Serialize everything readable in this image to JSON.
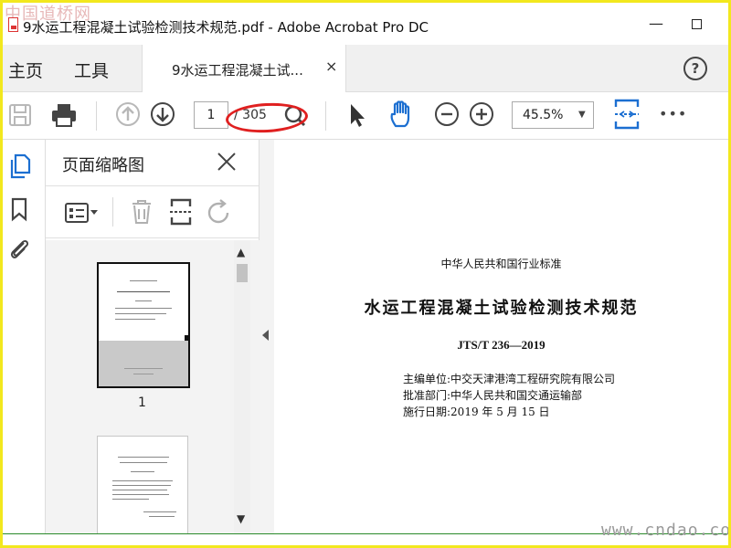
{
  "window": {
    "title": "9水运工程混凝土试验检测技术规范.pdf - Adobe Acrobat Pro DC",
    "minimize_glyph": "—",
    "watermark_top": "中国道桥网",
    "watermark_bottom": "www.cndao.com"
  },
  "tabs": {
    "home": "主页",
    "tools": "工具",
    "document": "9水运工程混凝土试...",
    "close_glyph": "×",
    "help_glyph": "?"
  },
  "toolbar": {
    "page_current": "1",
    "page_total": "/ 305",
    "zoom": "45.5%",
    "zoom_arrow": "▼",
    "more_glyph": "•••",
    "highlight_color": "#e02020",
    "accent_color": "#1c6fd1",
    "icons": [
      "save-icon",
      "print-icon",
      "prev-page-icon",
      "next-page-icon",
      "find-icon",
      "select-pointer-icon",
      "hand-tool-icon",
      "zoom-out-icon",
      "zoom-in-icon",
      "fit-page-icon",
      "more-icon"
    ]
  },
  "sidebar": {
    "icons": [
      "page-thumbnails-icon",
      "bookmark-icon",
      "attachment-icon"
    ]
  },
  "thumbnail_panel": {
    "title": "页面缩略图",
    "thumb_label": "1",
    "tool_icons": [
      "thumbnail-options-icon",
      "delete-page-icon",
      "insert-page-icon",
      "rotate-page-icon"
    ],
    "scroll_up": "▲",
    "scroll_down": "▼"
  },
  "document": {
    "standard": "中华人民共和国行业标准",
    "title": "水运工程混凝土试验检测技术规范",
    "code": "JTS/T 236—2019",
    "editor": "主编单位:中交天津港湾工程研究院有限公司",
    "approver": "批准部门:中华人民共和国交通运输部",
    "effective": "施行日期:2019 年 5 月 15 日"
  }
}
